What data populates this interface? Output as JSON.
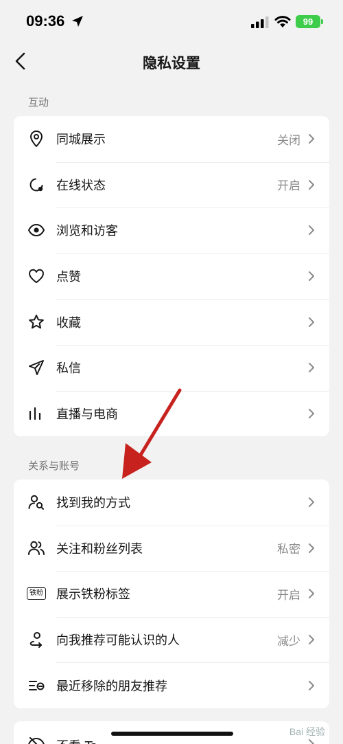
{
  "status": {
    "time": "09:36",
    "battery": "99"
  },
  "nav": {
    "title": "隐私设置"
  },
  "sections": [
    {
      "title": "互动",
      "items": [
        {
          "label": "同城展示",
          "value": "关闭",
          "icon": "location-pin-icon"
        },
        {
          "label": "在线状态",
          "value": "开启",
          "icon": "online-status-icon"
        },
        {
          "label": "浏览和访客",
          "value": "",
          "icon": "eye-icon"
        },
        {
          "label": "点赞",
          "value": "",
          "icon": "heart-icon"
        },
        {
          "label": "收藏",
          "value": "",
          "icon": "star-icon"
        },
        {
          "label": "私信",
          "value": "",
          "icon": "paper-plane-icon"
        },
        {
          "label": "直播与电商",
          "value": "",
          "icon": "bars-icon"
        }
      ]
    },
    {
      "title": "关系与账号",
      "items": [
        {
          "label": "找到我的方式",
          "value": "",
          "icon": "user-search-icon"
        },
        {
          "label": "关注和粉丝列表",
          "value": "私密",
          "icon": "users-icon"
        },
        {
          "label": "展示铁粉标签",
          "value": "开启",
          "icon": "fan-badge-icon",
          "badge": "铁粉"
        },
        {
          "label": "向我推荐可能认识的人",
          "value": "减少",
          "icon": "user-recommend-icon"
        },
        {
          "label": "最近移除的朋友推荐",
          "value": "",
          "icon": "removed-list-icon"
        }
      ]
    },
    {
      "title": "",
      "items": [
        {
          "label": "不看 Ta",
          "value": "",
          "icon": "eye-off-icon"
        }
      ]
    }
  ],
  "watermark": "Bai 经验"
}
